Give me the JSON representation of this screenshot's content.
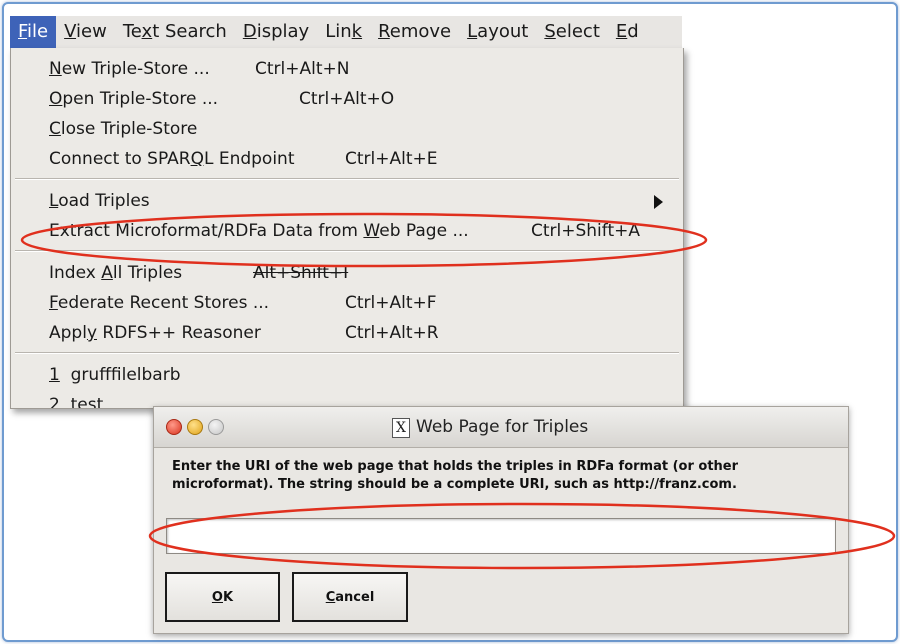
{
  "menubar": {
    "items": [
      {
        "pre": "",
        "u": "F",
        "post": "ile"
      },
      {
        "pre": "",
        "u": "V",
        "post": "iew"
      },
      {
        "pre": "Te",
        "u": "x",
        "post": "t Search"
      },
      {
        "pre": "",
        "u": "D",
        "post": "isplay"
      },
      {
        "pre": "Lin",
        "u": "k",
        "post": ""
      },
      {
        "pre": "",
        "u": "R",
        "post": "emove"
      },
      {
        "pre": "",
        "u": "L",
        "post": "ayout"
      },
      {
        "pre": "",
        "u": "S",
        "post": "elect"
      },
      {
        "pre": "",
        "u": "E",
        "post": "d"
      }
    ]
  },
  "file_menu": {
    "new_store": {
      "pre": "",
      "u": "N",
      "post": "ew Triple-Store ...",
      "shortcut": "Ctrl+Alt+N"
    },
    "open_store": {
      "pre": "",
      "u": "O",
      "post": "pen Triple-Store ...",
      "shortcut": "Ctrl+Alt+O"
    },
    "close_store": {
      "pre": "",
      "u": "C",
      "post": "lose Triple-Store",
      "shortcut": ""
    },
    "connect_sparql": {
      "pre": "Connect to SPAR",
      "u": "Q",
      "post": "L Endpoint",
      "shortcut": "Ctrl+Alt+E"
    },
    "load_triples": {
      "pre": "",
      "u": "L",
      "post": "oad Triples",
      "shortcut": ""
    },
    "extract": {
      "pre": "Extract Microformat/RDFa Data from ",
      "u": "W",
      "post": "eb Page ...",
      "shortcut": "Ctrl+Shift+A"
    },
    "index_all": {
      "pre": "Index ",
      "u": "A",
      "post": "ll Triples",
      "shortcut": "Alt+Shift+I"
    },
    "federate": {
      "pre": "",
      "u": "F",
      "post": "ederate Recent Stores ...",
      "shortcut": "Ctrl+Alt+F"
    },
    "apply_rdfs": {
      "pre": "Appl",
      "u": "y",
      "post": " RDFS++ Reasoner",
      "shortcut": "Ctrl+Alt+R"
    },
    "recent1": {
      "num": "1",
      "name": "grufffilelbarb"
    },
    "recent2": {
      "num": "2",
      "name": "test"
    }
  },
  "dialog": {
    "title": "Web Page for Triples",
    "title_icon": "x-window-icon",
    "message_line1": "Enter the URI of the web page that holds the triples in RDFa format (or other",
    "message_line2": "microformat).  The string should be a complete URI, such as http://franz.com.",
    "uri_value": "",
    "ok": {
      "u": "O",
      "post": "K"
    },
    "cancel": {
      "u": "C",
      "post": "ancel"
    }
  },
  "colors": {
    "menu_highlight": "#3e63b8",
    "annotation_ellipse": "#e0301e",
    "frame_border": "#6f9bd0"
  }
}
